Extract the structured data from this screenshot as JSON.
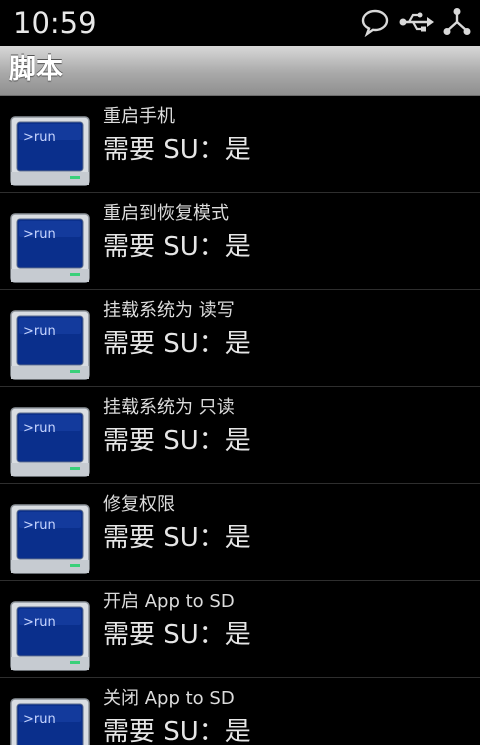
{
  "status_bar": {
    "time": "10:59",
    "icons": [
      "chat-bubble-icon",
      "usb-icon",
      "debug-icon"
    ]
  },
  "title_bar": {
    "title": "脚本"
  },
  "script_icon": {
    "label": ">run",
    "screen_color": "#0a2f8c",
    "indicator_color": "#3ad07a"
  },
  "scripts": [
    {
      "title": "重启手机",
      "subtitle": "需要 SU：是"
    },
    {
      "title": "重启到恢复模式",
      "subtitle": "需要 SU：是"
    },
    {
      "title": "挂载系统为 读写",
      "subtitle": "需要 SU：是"
    },
    {
      "title": "挂载系统为 只读",
      "subtitle": "需要 SU：是"
    },
    {
      "title": "修复权限",
      "subtitle": "需要 SU：是"
    },
    {
      "title": "开启 App to SD",
      "subtitle": "需要 SU：是"
    },
    {
      "title": "关闭 App to SD",
      "subtitle": "需要 SU：是"
    }
  ]
}
